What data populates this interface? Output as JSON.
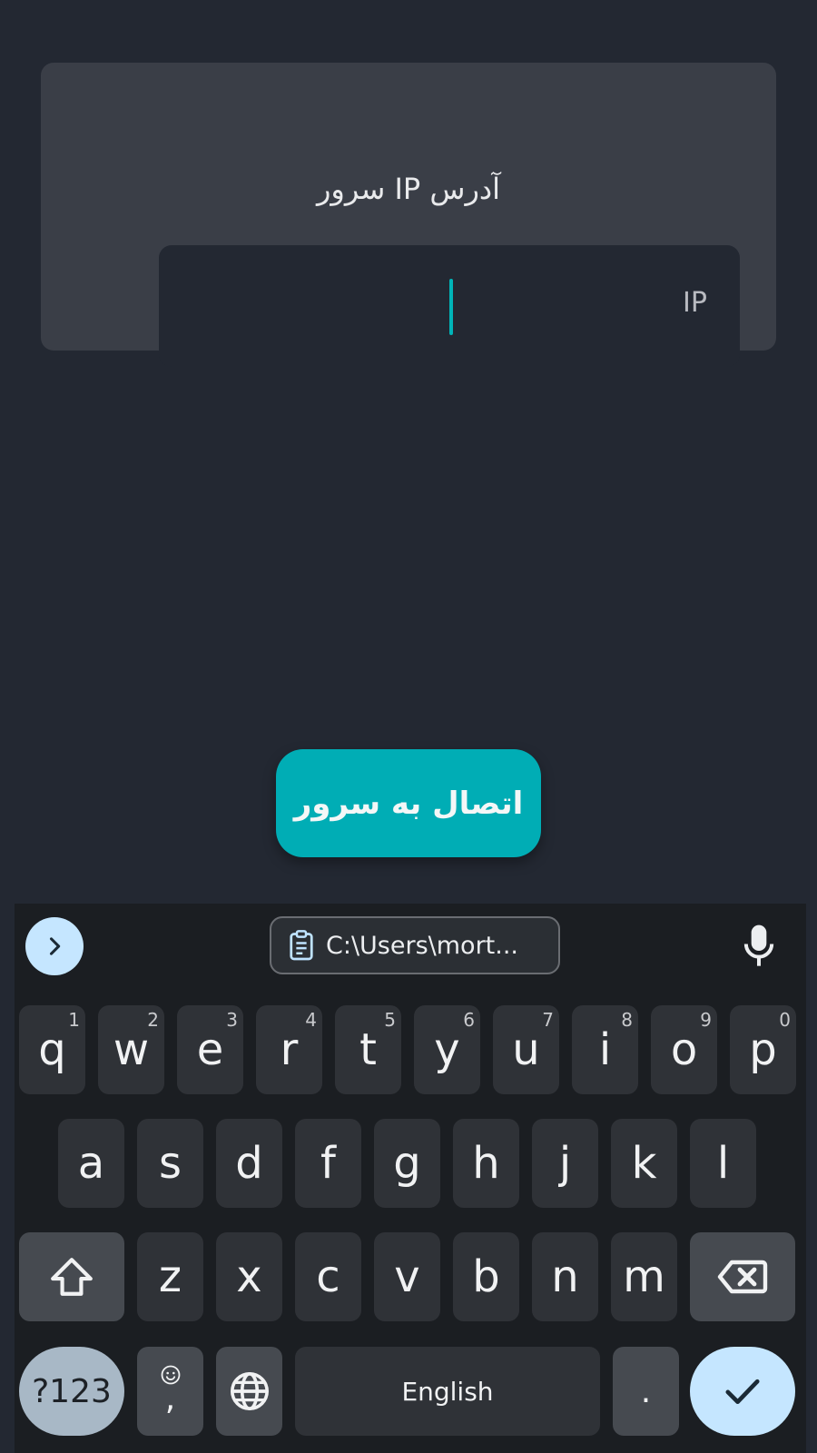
{
  "card": {
    "title": "آدرس IP سرور",
    "input_placeholder": "IP",
    "input_value": ""
  },
  "connect_button": {
    "label": "اتصال به سرور"
  },
  "keyboard": {
    "clipboard_text": "C:\\Users\\mort...",
    "row1": [
      {
        "key": "q",
        "hint": "1"
      },
      {
        "key": "w",
        "hint": "2"
      },
      {
        "key": "e",
        "hint": "3"
      },
      {
        "key": "r",
        "hint": "4"
      },
      {
        "key": "t",
        "hint": "5"
      },
      {
        "key": "y",
        "hint": "6"
      },
      {
        "key": "u",
        "hint": "7"
      },
      {
        "key": "i",
        "hint": "8"
      },
      {
        "key": "o",
        "hint": "9"
      },
      {
        "key": "p",
        "hint": "0"
      }
    ],
    "row2": [
      "a",
      "s",
      "d",
      "f",
      "g",
      "h",
      "j",
      "k",
      "l"
    ],
    "row3": [
      "z",
      "x",
      "c",
      "v",
      "b",
      "n",
      "m"
    ],
    "symbols_label": "?123",
    "comma_label": ",",
    "space_label": "English",
    "period_label": ".",
    "colors": {
      "accent": "#00adb5",
      "keyboard_accent": "#c5e6ff"
    }
  }
}
